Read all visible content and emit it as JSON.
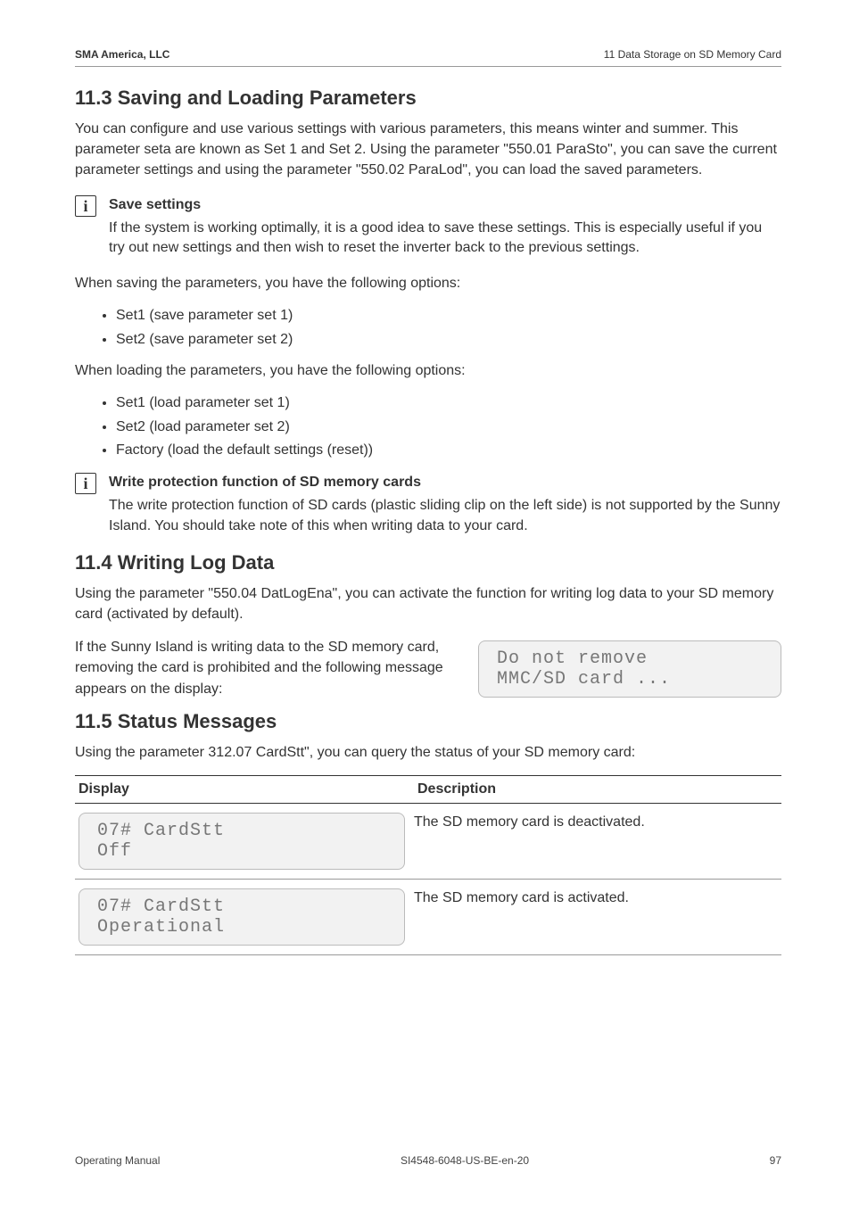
{
  "header": {
    "left": "SMA America, LLC",
    "right": "11  Data Storage on SD Memory Card"
  },
  "s113": {
    "title": "11.3 Saving and Loading Parameters",
    "intro": "You can configure and use various settings with various parameters, this means winter and summer. This parameter seta are known as Set 1 and Set 2. Using the parameter \"550.01 ParaSto\", you can save the current parameter settings and using the parameter \"550.02 ParaLod\", you can load the saved parameters.",
    "info1": {
      "title": "Save settings",
      "text": "If the system is working optimally, it is a good idea to save these settings. This is especially useful if you try out new settings and then wish to reset the inverter back to the previous settings."
    },
    "saving_lead": "When saving the parameters, you have the following options:",
    "saving_opts": [
      "Set1 (save parameter set 1)",
      "Set2 (save parameter set 2)"
    ],
    "loading_lead": "When loading the parameters, you have the following options:",
    "loading_opts": [
      "Set1 (load parameter set 1)",
      "Set2 (load parameter set 2)",
      "Factory (load the default settings (reset))"
    ],
    "info2": {
      "title": "Write protection function of SD memory cards",
      "text": "The write protection function of SD cards (plastic sliding clip on the left side) is not supported by the Sunny Island. You should take note of this when writing data to your card."
    }
  },
  "s114": {
    "title": "11.4 Writing Log Data",
    "intro": "Using the parameter \"550.04 DatLogEna\", you can activate the function for writing log data to your SD memory card (activated by default).",
    "para": "If the Sunny Island is writing data to the SD memory card, removing the card is prohibited and the following message appears on the display:",
    "lcd": {
      "line1": "Do not remove",
      "line2": "MMC/SD card ..."
    }
  },
  "s115": {
    "title": "11.5 Status Messages",
    "intro": "Using the parameter 312.07 CardStt\", you can query the status of your SD memory card:",
    "col_display": "Display",
    "col_desc": "Description",
    "rows": [
      {
        "lcd_line1": "07# CardStt",
        "lcd_line2": "Off",
        "desc": "The SD memory card is deactivated."
      },
      {
        "lcd_line1": "07# CardStt",
        "lcd_line2": "Operational",
        "desc": "The SD memory card is activated."
      }
    ]
  },
  "footer": {
    "left": "Operating Manual",
    "center": "SI4548-6048-US-BE-en-20",
    "right": "97"
  }
}
